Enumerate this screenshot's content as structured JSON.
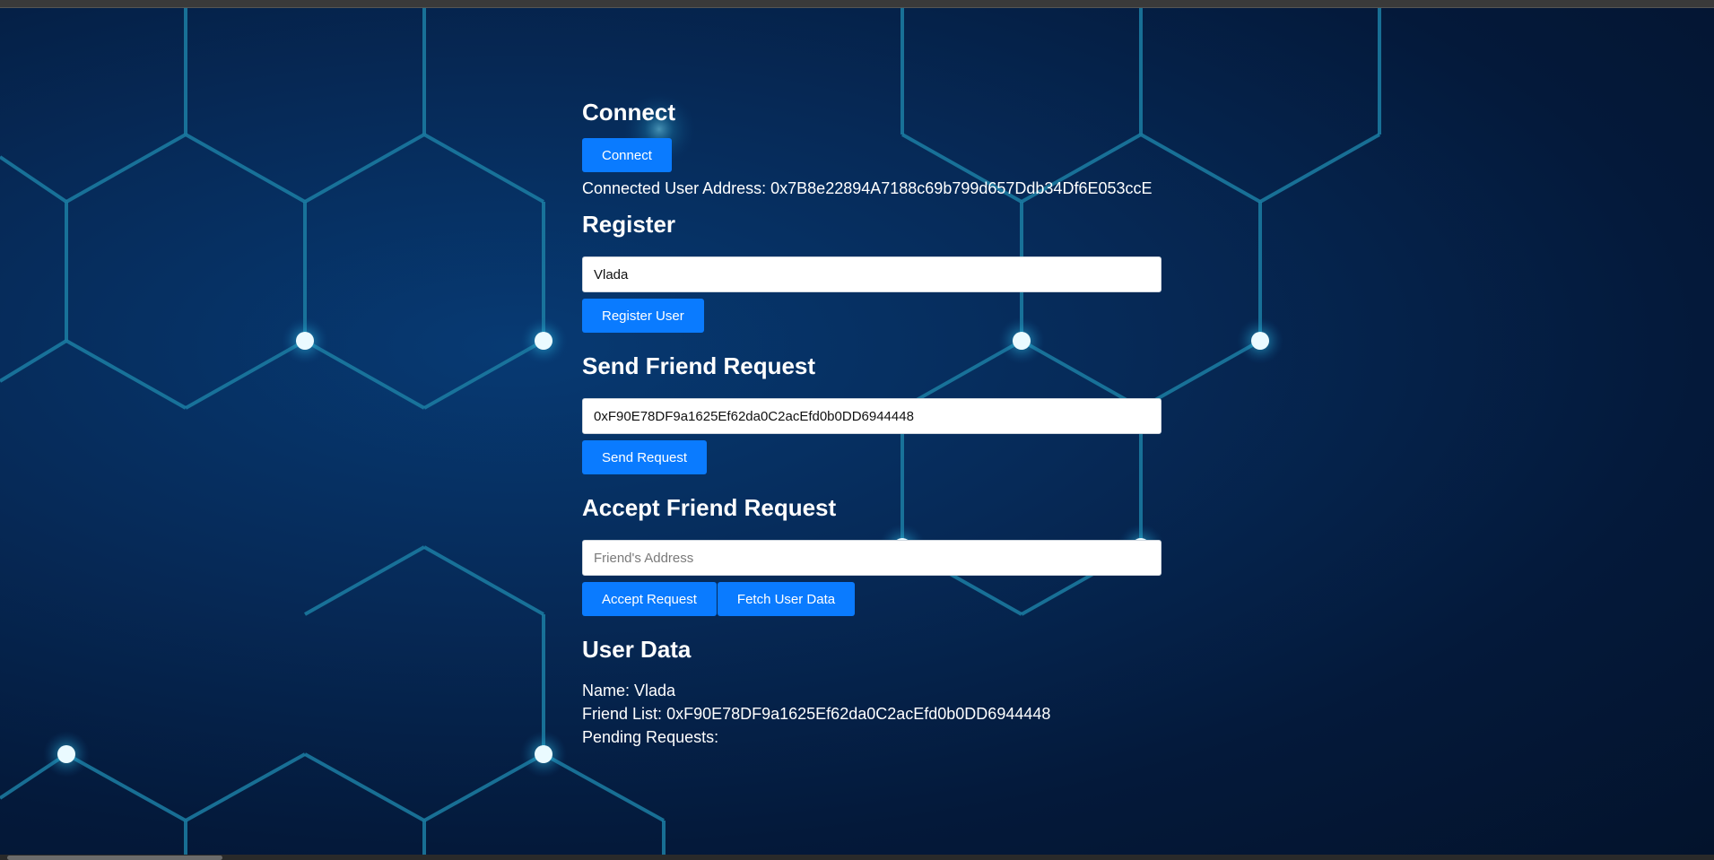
{
  "connect": {
    "heading": "Connect",
    "button_label": "Connect",
    "address_label": "Connected User Address:",
    "address_value": "0x7B8e22894A7188c69b799d657Ddb34Df6E053ccE"
  },
  "register": {
    "heading": "Register",
    "name_value": "Vlada",
    "button_label": "Register User"
  },
  "send_request": {
    "heading": "Send Friend Request",
    "address_value": "0xF90E78DF9a1625Ef62da0C2acEfd0b0DD6944448",
    "button_label": "Send Request"
  },
  "accept_request": {
    "heading": "Accept Friend Request",
    "address_value": "",
    "address_placeholder": "Friend's Address",
    "accept_label": "Accept Request",
    "fetch_label": "Fetch User Data"
  },
  "user_data": {
    "heading": "User Data",
    "name_label": "Name:",
    "name_value": "Vlada",
    "friend_list_label": "Friend List:",
    "friend_list_value": "0xF90E78DF9a1625Ef62da0C2acEfd0b0DD6944448",
    "pending_label": "Pending Requests:",
    "pending_value": ""
  },
  "theme": {
    "button_color": "#0a7bff",
    "background_color": "#062a58",
    "line_color": "#1c7ea3",
    "node_color": "#ffffff"
  }
}
